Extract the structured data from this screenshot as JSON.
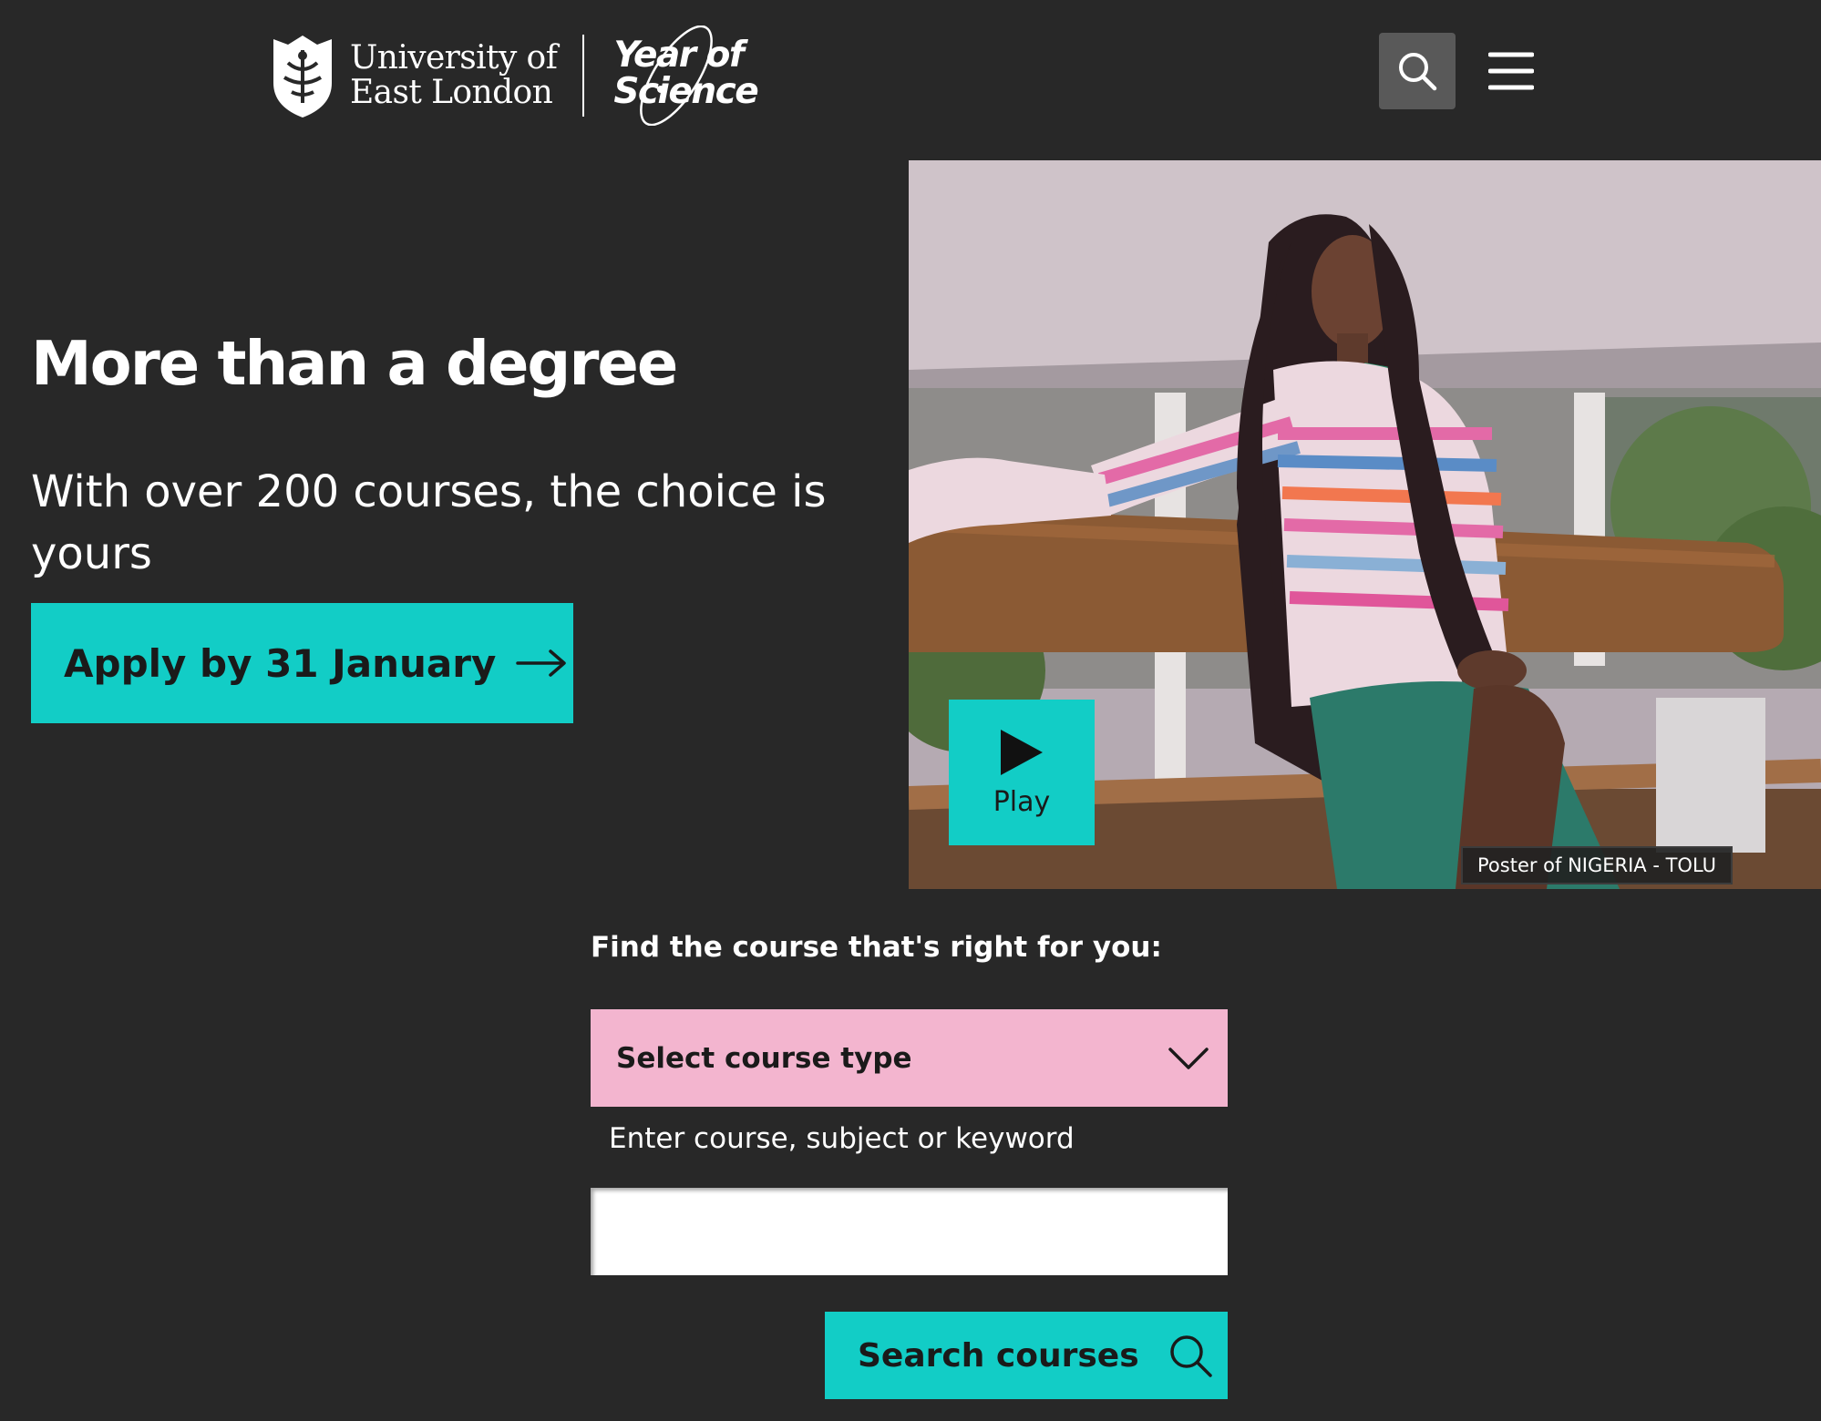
{
  "header": {
    "university_line1": "University of",
    "university_line2": "East London",
    "campaign_line1": "Year of",
    "campaign_line2": "Science",
    "search_icon": "search-icon",
    "menu_icon": "hamburger-menu-icon"
  },
  "hero": {
    "title": "More than a degree",
    "subtitle": "With over 200 courses, the choice is yours",
    "apply_label": "Apply by 31 January",
    "apply_icon": "arrow-right-icon"
  },
  "video": {
    "play_label": "Play",
    "play_icon": "play-icon",
    "caption": "Poster of NIGERIA - TOLU"
  },
  "finder": {
    "heading": "Find the course that's right for you:",
    "select_value": "Select course type",
    "select_icon": "chevron-down-icon",
    "keyword_label": "Enter course, subject or keyword",
    "keyword_value": "",
    "search_label": "Search courses",
    "search_icon": "search-icon"
  },
  "colors": {
    "background": "#282828",
    "accent_teal": "#12cdc6",
    "select_pink": "#f3b5cf",
    "header_button": "#595959"
  }
}
